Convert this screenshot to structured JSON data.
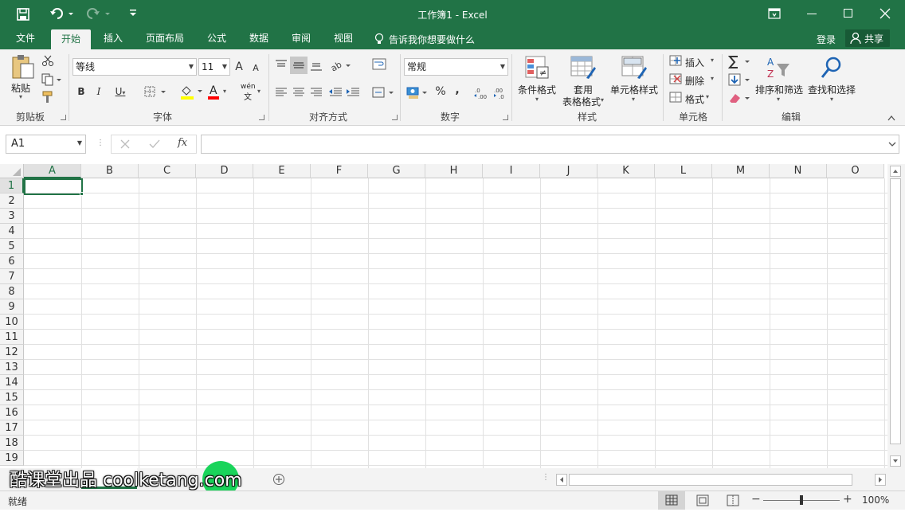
{
  "titlebar": {
    "title": "工作簿1 - Excel",
    "save_icon": "save-icon",
    "undo_icon": "undo-icon",
    "redo_icon": "redo-icon",
    "customize_icon": "customize-qat-icon"
  },
  "tabs": [
    {
      "label": "文件"
    },
    {
      "label": "开始"
    },
    {
      "label": "插入"
    },
    {
      "label": "页面布局"
    },
    {
      "label": "公式"
    },
    {
      "label": "数据"
    },
    {
      "label": "审阅"
    },
    {
      "label": "视图"
    }
  ],
  "tellme": "告诉我你想要做什么",
  "login": "登录",
  "share": "共享",
  "ribbon": {
    "clipboard": {
      "paste": "粘贴",
      "group": "剪贴板"
    },
    "font": {
      "name": "等线",
      "size": "11",
      "bold": "B",
      "italic": "I",
      "underline": "U",
      "fontcolor": "A",
      "wen": "wén",
      "grow": "A",
      "shrink": "A",
      "group": "字体"
    },
    "align": {
      "group": "对齐方式"
    },
    "number": {
      "format": "常规",
      "percent": "%",
      "comma": ",",
      "group": "数字"
    },
    "styles": {
      "cond": "条件格式",
      "table1": "套用",
      "table2": "表格格式",
      "cell": "单元格样式",
      "group": "样式"
    },
    "cells": {
      "insert": "插入",
      "delete": "删除",
      "format": "格式",
      "group": "单元格"
    },
    "editing": {
      "sort": "排序和筛选",
      "find": "查找和选择",
      "group": "编辑"
    }
  },
  "formula_bar": {
    "namebox": "A1",
    "fx": "fx",
    "value": ""
  },
  "columns": [
    "A",
    "B",
    "C",
    "D",
    "E",
    "F",
    "G",
    "H",
    "I",
    "J",
    "K",
    "L",
    "M",
    "N",
    "O"
  ],
  "rows": [
    "1",
    "2",
    "3",
    "4",
    "5",
    "6",
    "7",
    "8",
    "9",
    "10",
    "11",
    "12",
    "13",
    "14",
    "15",
    "16",
    "17",
    "18",
    "19"
  ],
  "status": {
    "ready": "就绪",
    "zoom": "100%",
    "zoom_level": 0.5
  },
  "watermark": "酷课堂出品 coolketang.com",
  "colors": {
    "accent": "#217346",
    "ribbon_bg": "#f3f3f3",
    "selection": "#217346"
  }
}
